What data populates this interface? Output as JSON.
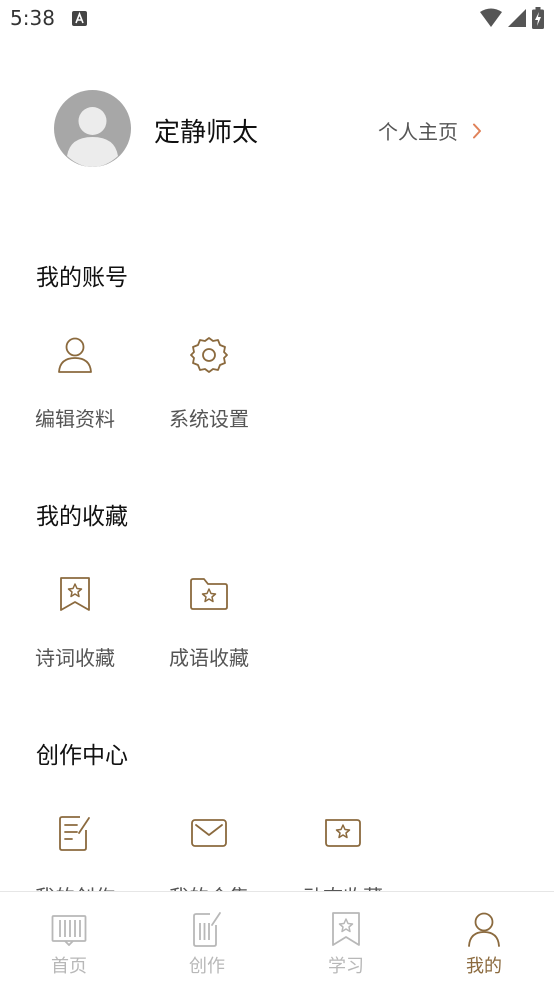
{
  "status_bar": {
    "time": "5:38",
    "icons": [
      "notification-a-icon",
      "wifi-icon",
      "signal-icon",
      "battery-charging-icon"
    ]
  },
  "profile": {
    "username": "定静师太",
    "homepage_label": "个人主页",
    "avatar_icon": "default-avatar-icon"
  },
  "sections": {
    "account": {
      "title": "我的账号",
      "items": [
        {
          "label": "编辑资料",
          "icon": "user-outline-icon"
        },
        {
          "label": "系统设置",
          "icon": "gear-icon"
        }
      ]
    },
    "favorites": {
      "title": "我的收藏",
      "items": [
        {
          "label": "诗词收藏",
          "icon": "bookmark-star-icon"
        },
        {
          "label": "成语收藏",
          "icon": "folder-star-icon"
        }
      ]
    },
    "creation": {
      "title": "创作中心",
      "items": [
        {
          "label": "我的创作",
          "icon": "edit-document-icon"
        },
        {
          "label": "我的合集",
          "icon": "envelope-icon"
        },
        {
          "label": "动态收藏",
          "icon": "star-box-icon"
        }
      ]
    }
  },
  "tab_bar": {
    "tabs": [
      {
        "label": "首页",
        "icon": "home-books-icon",
        "active": false
      },
      {
        "label": "创作",
        "icon": "create-edit-icon",
        "active": false
      },
      {
        "label": "学习",
        "icon": "study-bookmark-icon",
        "active": false
      },
      {
        "label": "我的",
        "icon": "person-icon",
        "active": true
      }
    ]
  },
  "colors": {
    "accent": "#8b6a3e",
    "chevron": "#e0825a",
    "inactive_tab": "#b8b8b8",
    "avatar_bg": "#a7a7a7"
  }
}
